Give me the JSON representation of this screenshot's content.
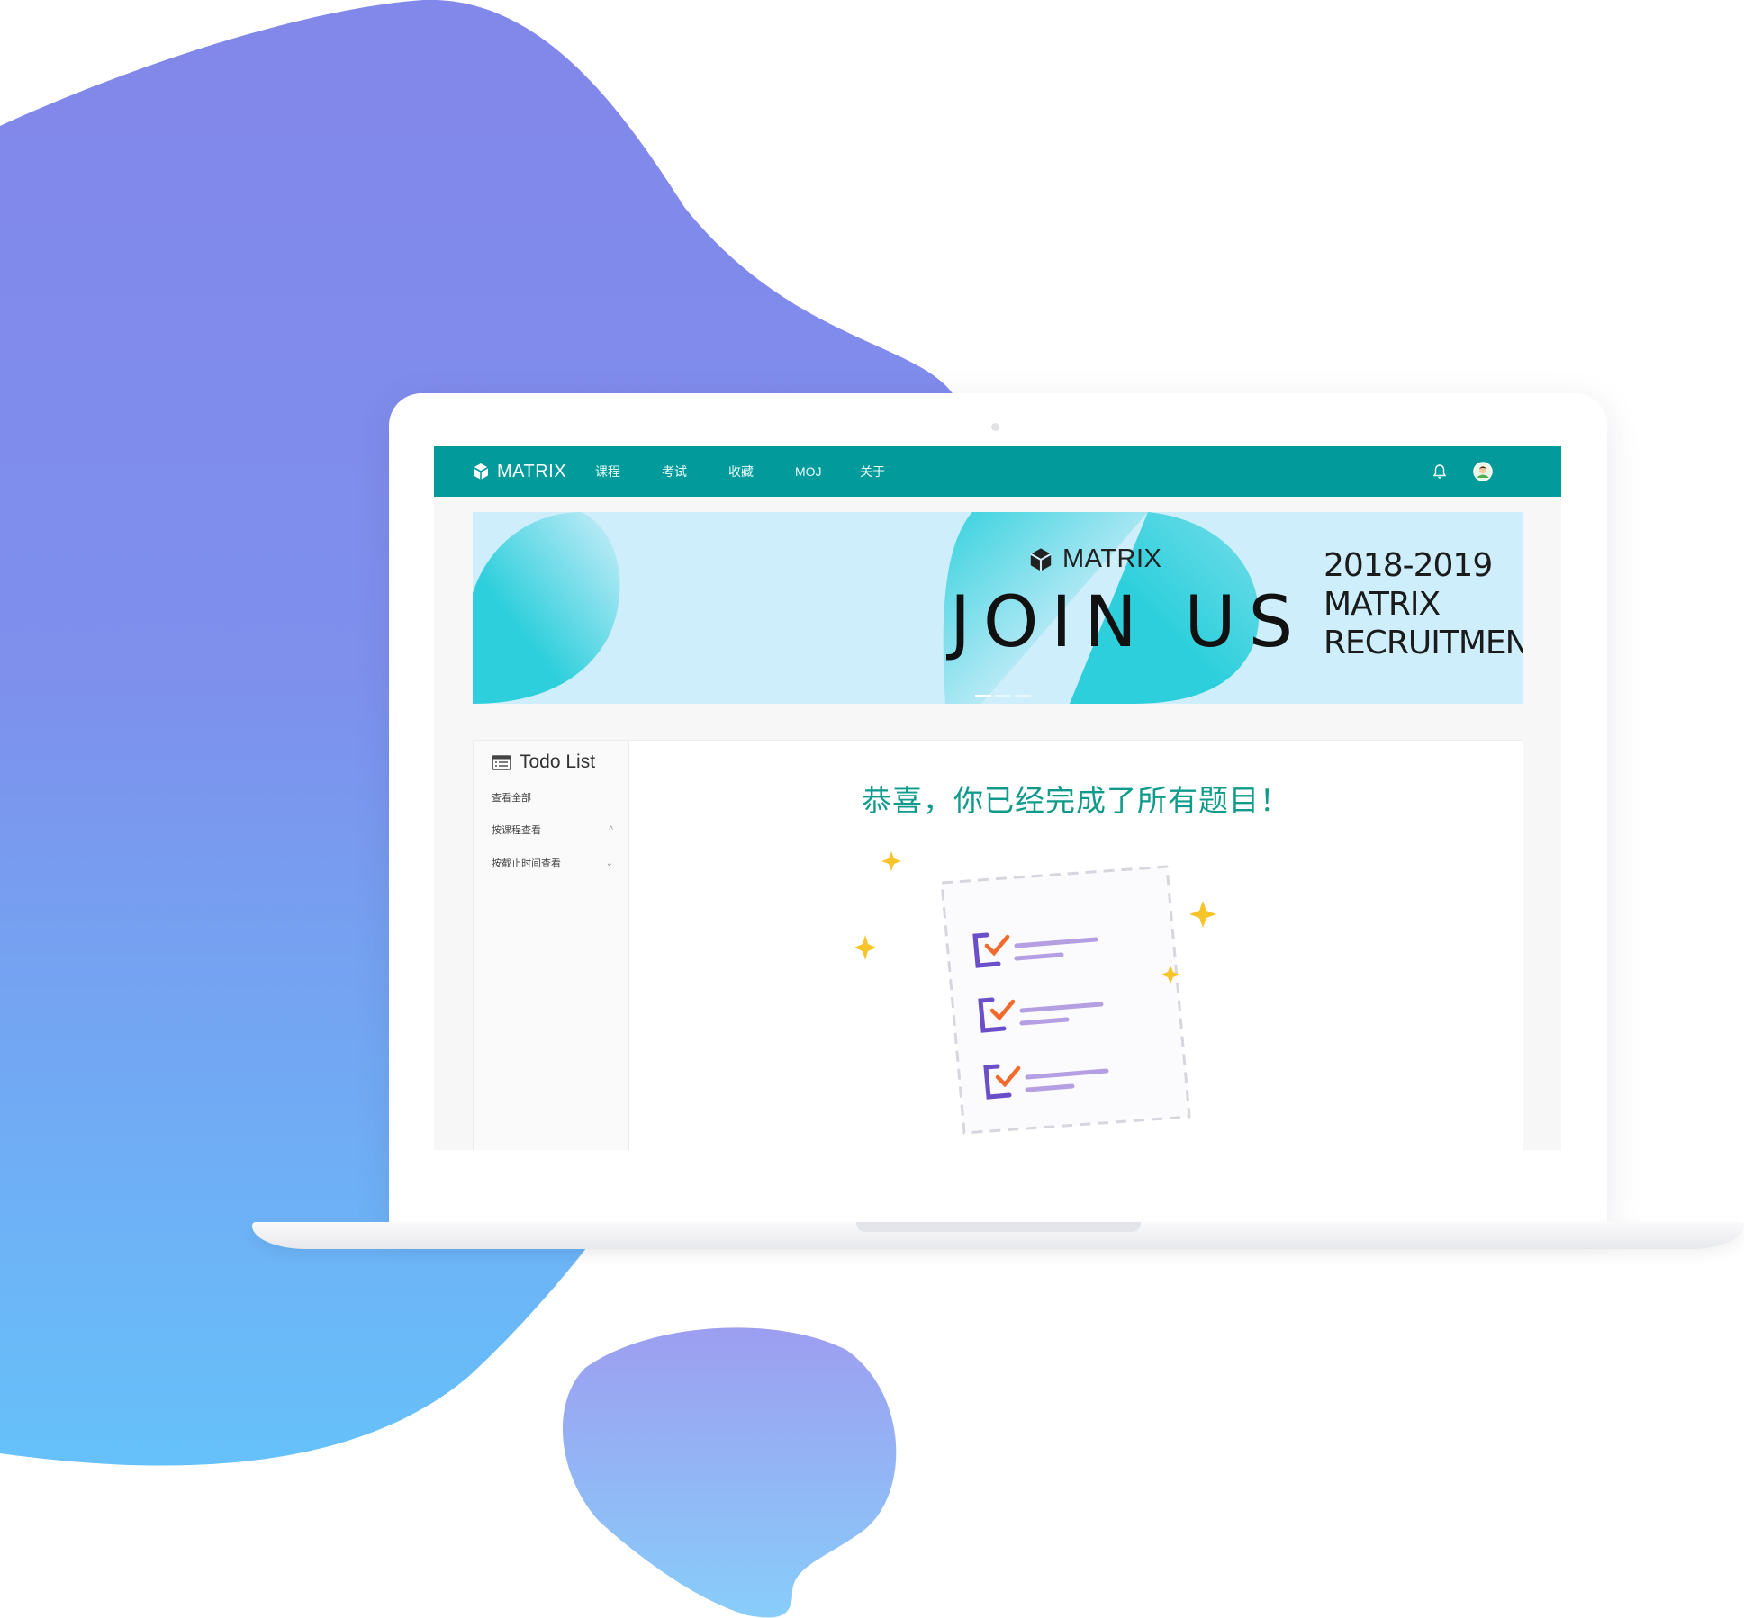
{
  "navbar": {
    "brand": "MATRIX",
    "items": [
      "课程",
      "考试",
      "收藏",
      "MOJ",
      "关于"
    ],
    "icons": [
      "bell-icon",
      "avatar"
    ]
  },
  "banner": {
    "brand": "MATRIX",
    "headline": "JOIN US",
    "years": "2018-2019",
    "line2": "MATRIX",
    "line3": "RECRUITMENT"
  },
  "sidebar": {
    "title": "Todo List",
    "items": [
      {
        "label": "查看全部",
        "chevron": ""
      },
      {
        "label": "按课程查看",
        "chevron": "^"
      },
      {
        "label": "按截止时间查看",
        "chevron": "⌄"
      }
    ]
  },
  "main": {
    "message": "恭喜，你已经完成了所有题目！"
  },
  "colors": {
    "nav_bg": "#029a9a",
    "banner_bg": "#cdeefa",
    "accent_teal": "#2fd0dc",
    "message_color": "#0f9a8c",
    "blob_top": "#8288ea",
    "blob_bottom": "#66c1fa"
  }
}
